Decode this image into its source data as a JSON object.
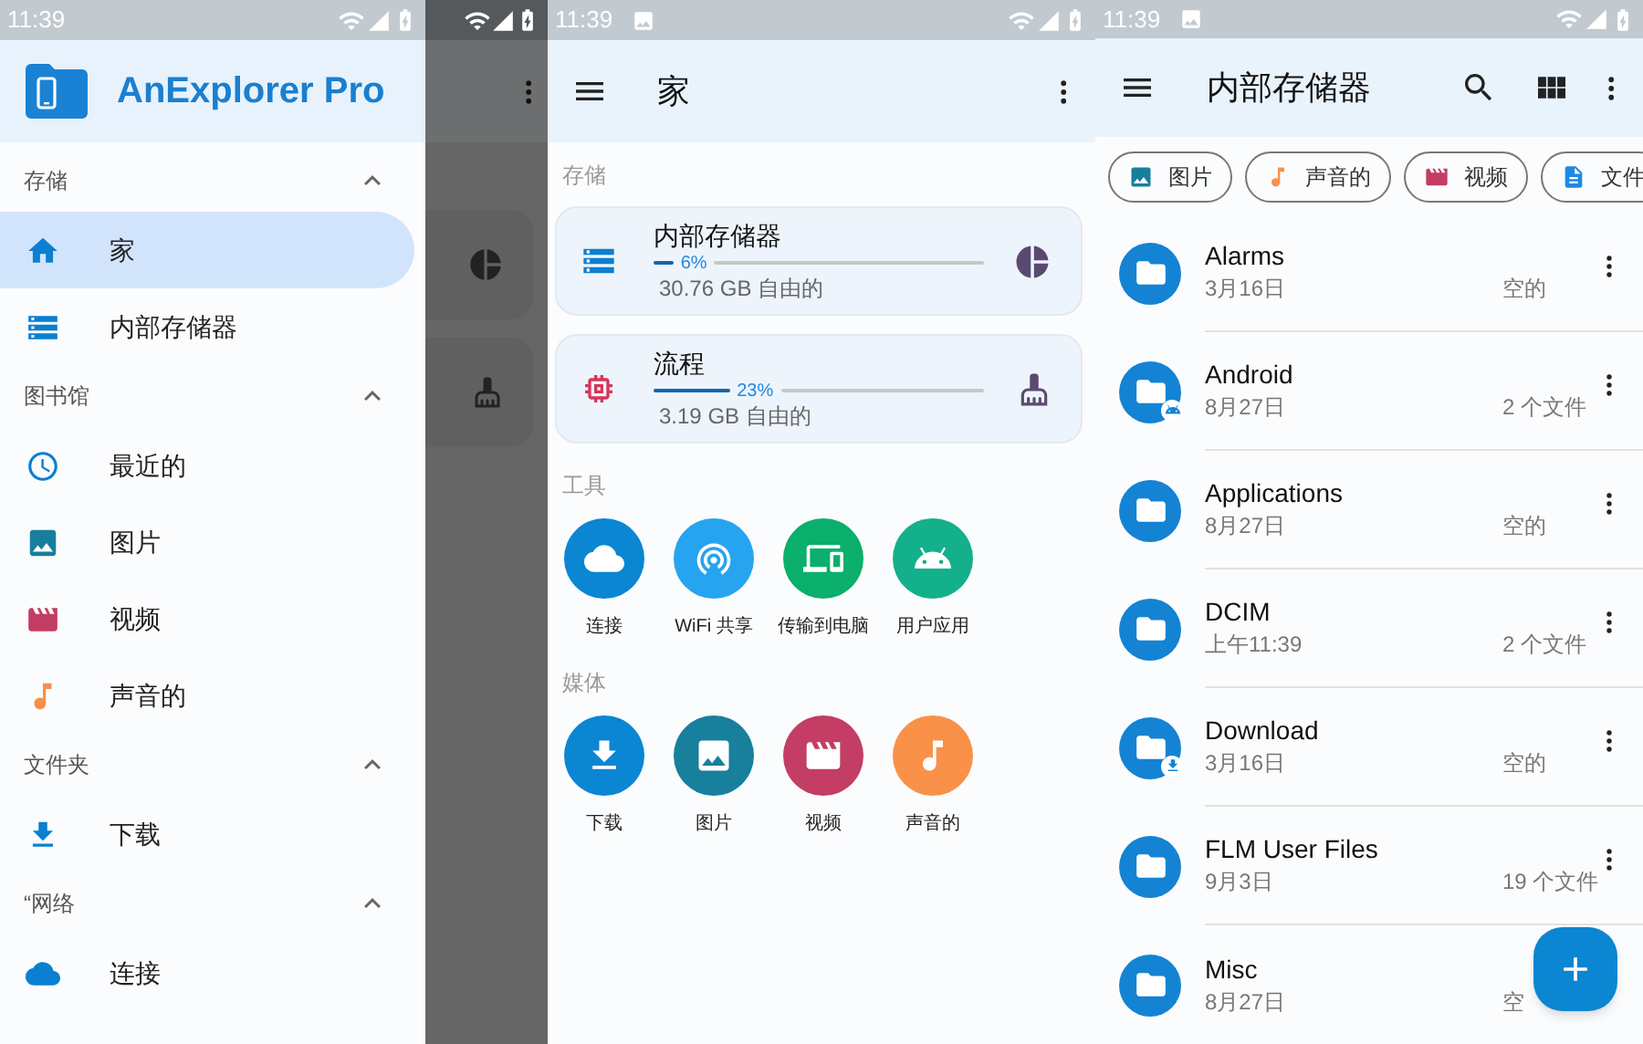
{
  "drawer_screen": {
    "status_bar": {
      "time": "11:39"
    },
    "app_title": "AnExplorer Pro",
    "sections": [
      {
        "title": "存储",
        "expanded": true,
        "items": [
          {
            "label": "家",
            "kind": "home",
            "selected": true
          },
          {
            "label": "内部存储器",
            "kind": "storage",
            "selected": false
          }
        ]
      },
      {
        "title": "图书馆",
        "expanded": true,
        "items": [
          {
            "label": "最近的",
            "kind": "recent",
            "selected": false
          },
          {
            "label": "图片",
            "kind": "image",
            "selected": false
          },
          {
            "label": "视频",
            "kind": "video",
            "selected": false
          },
          {
            "label": "声音的",
            "kind": "audio",
            "selected": false
          }
        ]
      },
      {
        "title": "文件夹",
        "expanded": true,
        "items": [
          {
            "label": "下载",
            "kind": "download",
            "selected": false
          }
        ]
      },
      {
        "title": "“网络",
        "expanded": true,
        "items": [
          {
            "label": "连接",
            "kind": "cloud",
            "selected": false
          }
        ]
      }
    ]
  },
  "home_screen": {
    "status_bar": {
      "time": "11:39"
    },
    "title": "家",
    "storage_heading": "存储",
    "storage_cards": [
      {
        "name": "内部存储器",
        "kind": "storage",
        "level": 0.06,
        "percent": "6%",
        "free": "30.76 GB 自由的"
      },
      {
        "name": "流程",
        "kind": "memory",
        "level": 0.23,
        "percent": "23%",
        "free": "3.19 GB 自由的"
      }
    ],
    "tools_heading": "工具",
    "tools": [
      {
        "label": "连接",
        "kind": "cloud",
        "color": "#0b86d2"
      },
      {
        "label": "WiFi 共享",
        "kind": "wifi",
        "color": "#26a4f0"
      },
      {
        "label": "传输到电脑",
        "kind": "devices",
        "color": "#0aaf6b"
      },
      {
        "label": "用户应用",
        "kind": "android",
        "color": "#13b08b"
      }
    ],
    "media_heading": "媒体",
    "media": [
      {
        "label": "下载",
        "kind": "download",
        "color": "#0b86d2"
      },
      {
        "label": "图片",
        "kind": "image",
        "color": "#187f9c"
      },
      {
        "label": "视频",
        "kind": "video",
        "color": "#c33d65"
      },
      {
        "label": "声音的",
        "kind": "audio",
        "color": "#f99148"
      }
    ]
  },
  "storage_screen": {
    "status_bar": {
      "time": "11:39"
    },
    "title": "内部存储器",
    "chips": [
      {
        "label": "图片",
        "kind": "image"
      },
      {
        "label": "声音的",
        "kind": "audio"
      },
      {
        "label": "视频",
        "kind": "video"
      },
      {
        "label": "文件",
        "kind": "document"
      }
    ],
    "files": [
      {
        "name": "Alarms",
        "date": "3月16日",
        "info": "空的",
        "kind": "folder"
      },
      {
        "name": "Android",
        "date": "8月27日",
        "info": "2 个文件",
        "kind": "android"
      },
      {
        "name": "Applications",
        "date": "8月27日",
        "info": "空的",
        "kind": "folder"
      },
      {
        "name": "DCIM",
        "date": "上午11:39",
        "info": "2 个文件",
        "kind": "folder"
      },
      {
        "name": "Download",
        "date": "3月16日",
        "info": "空的",
        "kind": "download"
      },
      {
        "name": "FLM User Files",
        "date": "9月3日",
        "info": "19 个文件",
        "kind": "folder"
      },
      {
        "name": "Misc",
        "date": "8月27日",
        "info": "空",
        "kind": "folder"
      }
    ]
  }
}
